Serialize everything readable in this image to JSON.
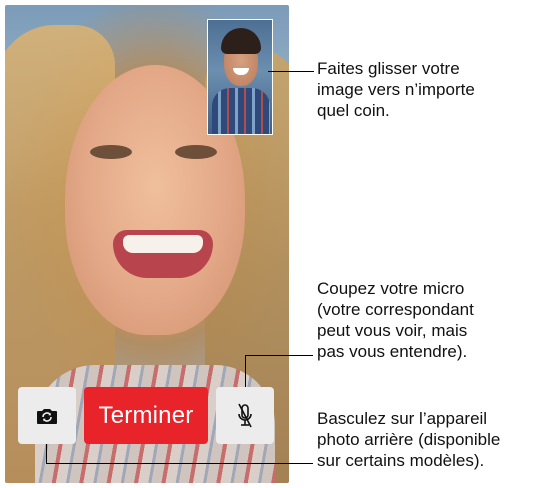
{
  "call": {
    "end_button_label": "Terminer",
    "camera_button_icon": "camera-flip-icon",
    "mute_button_icon": "microphone-mute-icon"
  },
  "annotations": {
    "pip_lines": [
      "Faites glisser votre",
      "image vers n’importe",
      "quel coin."
    ],
    "mute_lines": [
      "Coupez votre micro",
      "(votre correspondant",
      "peut vous voir, mais",
      "pas vous entendre)."
    ],
    "camera_lines": [
      "Basculez sur l’appareil",
      "photo arrière (disponible",
      "sur certains modèles)."
    ]
  },
  "colors": {
    "end_button": "#e8232a",
    "control_buttons": "#ececec"
  }
}
